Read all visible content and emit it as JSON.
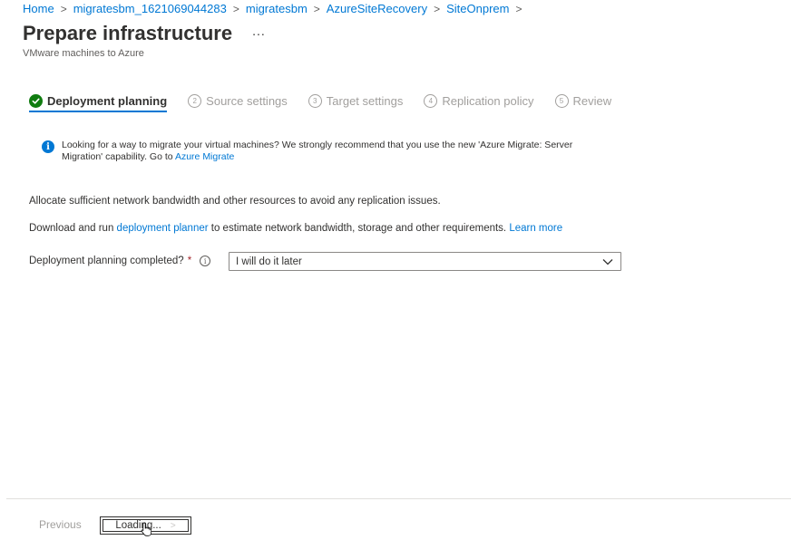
{
  "breadcrumb": [
    {
      "label": "Home"
    },
    {
      "label": "migratesbm_1621069044283"
    },
    {
      "label": "migratesbm"
    },
    {
      "label": "AzureSiteRecovery"
    },
    {
      "label": "SiteOnprem"
    }
  ],
  "breadcrumb_sep": ">",
  "header": {
    "title": "Prepare infrastructure",
    "more": "...",
    "subtitle": "VMware machines to Azure"
  },
  "steps": [
    {
      "label": "Deployment planning",
      "state": "completed"
    },
    {
      "number": "2",
      "label": "Source settings"
    },
    {
      "number": "3",
      "label": "Target settings"
    },
    {
      "number": "4",
      "label": "Replication policy"
    },
    {
      "number": "5",
      "label": "Review"
    }
  ],
  "info": {
    "icon": "info-icon",
    "text": "Looking for a way to migrate your virtual machines? We strongly recommend that you use the new 'Azure Migrate: Server Migration' capability. Go to ",
    "link": "Azure Migrate"
  },
  "content": {
    "para1": "Allocate sufficient network bandwidth and other resources to avoid any replication issues.",
    "para2_prefix": "Download and run ",
    "para2_link": "deployment planner",
    "para2_middle": " to estimate network bandwidth, storage and other requirements. ",
    "para2_learn": "Learn more"
  },
  "field": {
    "label": "Deployment planning completed?",
    "required_mark": "*",
    "help": "i",
    "value": "I will do it later"
  },
  "footer": {
    "previous": "Previous",
    "next": "Loading...",
    "next_chevron": ">"
  },
  "colors": {
    "link": "#0078d4",
    "success": "#107c10",
    "disabled": "#a19f9d",
    "required": "#a4262c"
  }
}
